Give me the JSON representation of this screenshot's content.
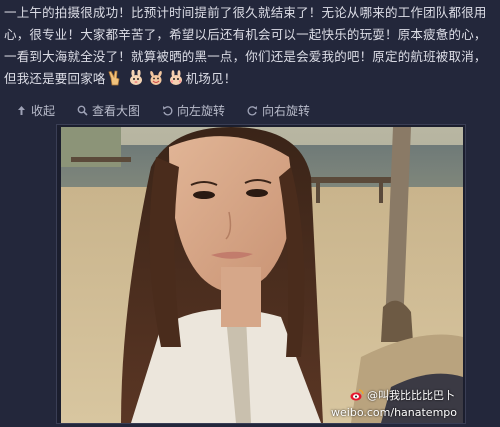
{
  "post": {
    "text_before_emoji": "一上午的拍摄很成功！比预计时间提前了很久就结束了！无论从哪来的工作团队都很用心，很专业！大家都辛苦了，希望以后还有机会可以一起快乐的玩耍！原本疲惫的心，一看到大海就全没了！就算被晒的黑一点，你们还是会爱我的吧！原定的航班被取消，但我还是要回家咯",
    "text_after_emoji": "机场见！"
  },
  "toolbar": {
    "collapse_label": "收起",
    "view_large_label": "查看大图",
    "rotate_left_label": "向左旋转",
    "rotate_right_label": "向右旋转"
  },
  "photo": {
    "watermark_name": "@叫我比比比巴卜",
    "watermark_url": "weibo.com/hanatempo"
  }
}
